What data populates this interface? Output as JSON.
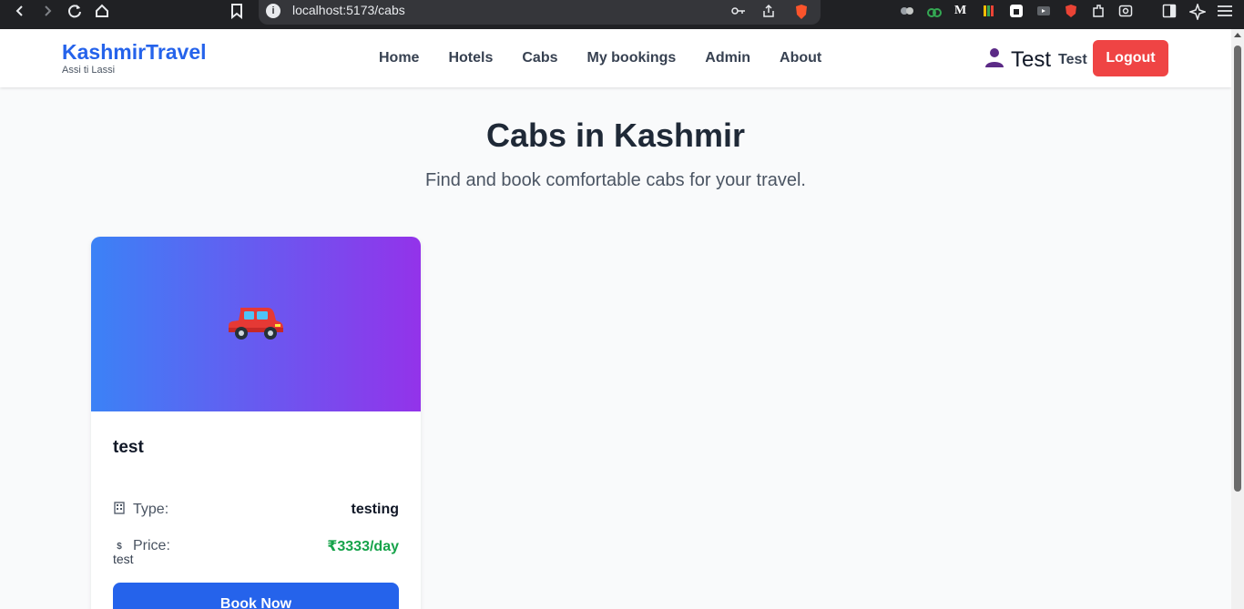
{
  "browser": {
    "url": "localhost:5173/cabs"
  },
  "header": {
    "brand_name": "KashmirTravel",
    "brand_tagline": "Assi ti Lassi",
    "nav": [
      "Home",
      "Hotels",
      "Cabs",
      "My bookings",
      "Admin",
      "About"
    ],
    "user_name": "Test",
    "user_label": "Test",
    "logout_label": "Logout"
  },
  "hero": {
    "title": "Cabs in Kashmir",
    "subtitle": "Find and book comfortable cabs for your travel."
  },
  "cab": {
    "name": "test",
    "type_label": "Type:",
    "type_value": "testing",
    "price_label": "Price:",
    "price_value": "₹3333/day",
    "description": "test",
    "book_label": "Book Now"
  },
  "colors": {
    "brand": "#2563eb",
    "logout": "#ef4444",
    "price": "#16a34a",
    "gradient_start": "#3b82f6",
    "gradient_end": "#9333ea"
  },
  "icons": {
    "banner": "car-icon",
    "type": "building-icon",
    "price": "dollar-icon",
    "user": "user-avatar-icon"
  }
}
